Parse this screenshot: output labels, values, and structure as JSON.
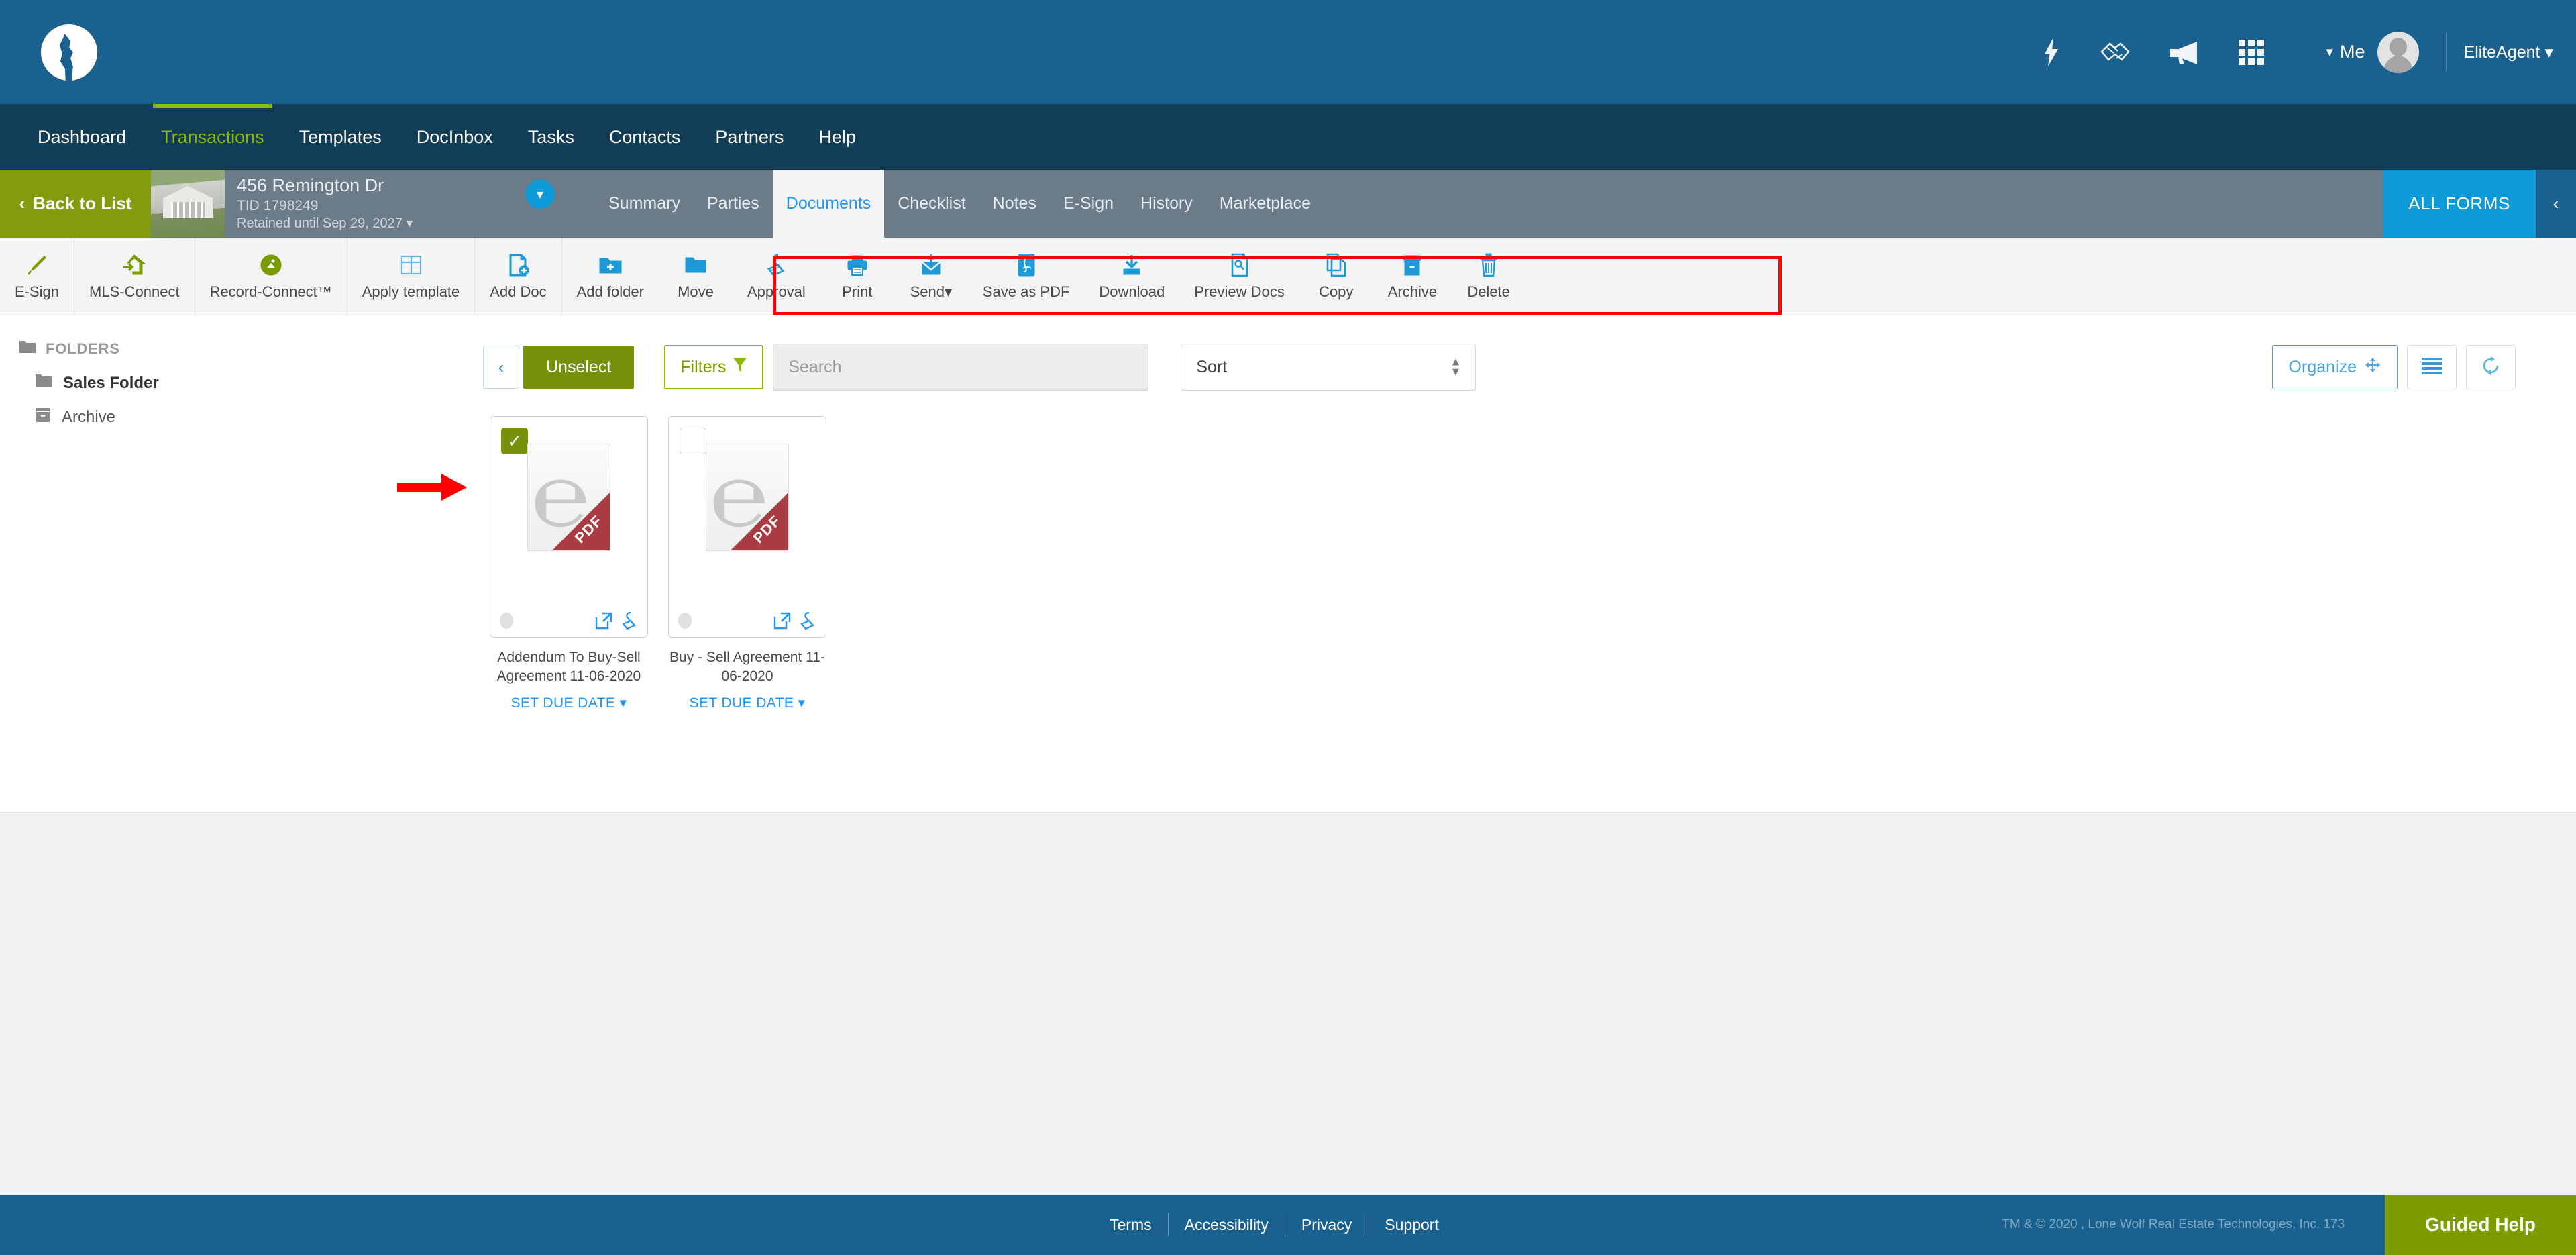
{
  "header": {
    "logo_alt": "lone-wolf-logo",
    "icons": [
      "lightning-icon",
      "handshake-icon",
      "megaphone-icon",
      "apps-grid-icon"
    ],
    "me_label": "Me",
    "agent_label": "EliteAgent",
    "brand_color": "#1a6190",
    "accent_green": "#8cb80b"
  },
  "nav": {
    "items": [
      {
        "label": "Dashboard",
        "active": false
      },
      {
        "label": "Transactions",
        "active": true
      },
      {
        "label": "Templates",
        "active": false
      },
      {
        "label": "DocInbox",
        "active": false
      },
      {
        "label": "Tasks",
        "active": false
      },
      {
        "label": "Contacts",
        "active": false
      },
      {
        "label": "Partners",
        "active": false
      },
      {
        "label": "Help",
        "active": false
      }
    ]
  },
  "transaction": {
    "back_label": "Back to List",
    "address": "456 Remington Dr",
    "tid": "TID 1798249",
    "retained": "Retained until Sep 29, 2027",
    "tabs": [
      {
        "label": "Summary",
        "active": false
      },
      {
        "label": "Parties",
        "active": false
      },
      {
        "label": "Documents",
        "active": true
      },
      {
        "label": "Checklist",
        "active": false
      },
      {
        "label": "Notes",
        "active": false
      },
      {
        "label": "E-Sign",
        "active": false
      },
      {
        "label": "History",
        "active": false
      },
      {
        "label": "Marketplace",
        "active": false
      }
    ],
    "all_forms_label": "ALL FORMS"
  },
  "toolbar": {
    "green_group": [
      {
        "label": "E-Sign",
        "icon": "pen-icon"
      },
      {
        "label": "MLS-Connect",
        "icon": "house-import-icon"
      },
      {
        "label": "Record-Connect™",
        "icon": "record-connect-icon"
      }
    ],
    "blue_group_left": [
      {
        "label": "Apply template",
        "icon": "grid-template-icon"
      },
      {
        "label": "Add Doc",
        "icon": "add-document-icon"
      },
      {
        "label": "Add folder",
        "icon": "add-folder-icon"
      }
    ],
    "highlighted_group": [
      {
        "label": "Move",
        "icon": "folder-icon"
      },
      {
        "label": "Approval",
        "icon": "stamp-icon"
      },
      {
        "label": "Print",
        "icon": "printer-icon"
      },
      {
        "label": "Send",
        "icon": "envelope-send-icon",
        "has_caret": true
      },
      {
        "label": "Save as PDF",
        "icon": "pdf-icon"
      },
      {
        "label": "Download",
        "icon": "download-icon"
      },
      {
        "label": "Preview Docs",
        "icon": "preview-doc-icon"
      },
      {
        "label": "Copy",
        "icon": "copy-icon"
      },
      {
        "label": "Archive",
        "icon": "archive-box-icon"
      },
      {
        "label": "Delete",
        "icon": "trash-icon"
      }
    ],
    "highlight_color": "#ff0000"
  },
  "sidebar": {
    "header": "FOLDERS",
    "items": [
      {
        "label": "Sales Folder",
        "icon": "folder-icon",
        "active": true
      },
      {
        "label": "Archive",
        "icon": "archive-box-icon",
        "active": false
      }
    ]
  },
  "controls": {
    "collapse_icon": "chevron-left-icon",
    "unselect_label": "Unselect",
    "filters_label": "Filters",
    "search_placeholder": "Search",
    "search_value": "",
    "sort_label": "Sort",
    "sort_options": [
      "Sort"
    ],
    "organize_label": "Organize",
    "list_view_icon": "list-view-icon",
    "refresh_icon": "refresh-icon"
  },
  "documents": [
    {
      "title": "Addendum To Buy-Sell Agreement 11-06-2020",
      "selected": true,
      "due_date_label": "SET DUE DATE",
      "thumb_type": "PDF",
      "actions": [
        "open-external-icon",
        "stamp-icon"
      ]
    },
    {
      "title": "Buy - Sell Agreement 11-06-2020",
      "selected": false,
      "due_date_label": "SET DUE DATE",
      "thumb_type": "PDF",
      "actions": [
        "open-external-icon",
        "stamp-icon"
      ]
    }
  ],
  "footer": {
    "links": [
      "Terms",
      "Accessibility",
      "Privacy",
      "Support"
    ],
    "copyright": "TM & © 2020 , Lone Wolf Real Estate Technologies, Inc. 173",
    "guided_help": "Guided Help"
  }
}
